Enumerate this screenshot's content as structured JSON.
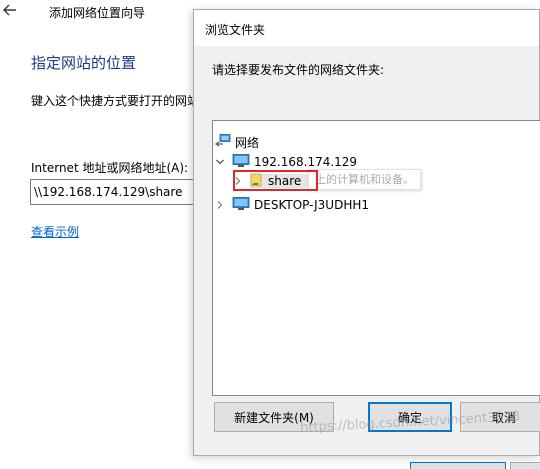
{
  "wizard": {
    "title": "添加网络位置向导",
    "heading": "指定网站的位置",
    "description": "键入这个快捷方式要打开的网站",
    "address_label": "Internet 地址或网络地址(A):",
    "address_value": "\\\\192.168.174.129\\share",
    "examples_link": "查看示例"
  },
  "dialog": {
    "title": "浏览文件夹",
    "prompt": "请选择要发布文件的网络文件夹:",
    "tree": {
      "root": "网络",
      "host": "192.168.174.129",
      "share": "share",
      "tooltip": "上的计算机和设备。",
      "desktop": "DESKTOP-J3UDHH1"
    },
    "buttons": {
      "new_folder": "新建文件夹(M)",
      "ok": "确定",
      "cancel": "取消"
    }
  },
  "watermark": "https://blog.csdn.net/vincent3678",
  "colors": {
    "link": "#0066cc",
    "heading": "#1a3a8f",
    "selection_outline": "#e0262a",
    "default_button_border": "#0078d7"
  }
}
